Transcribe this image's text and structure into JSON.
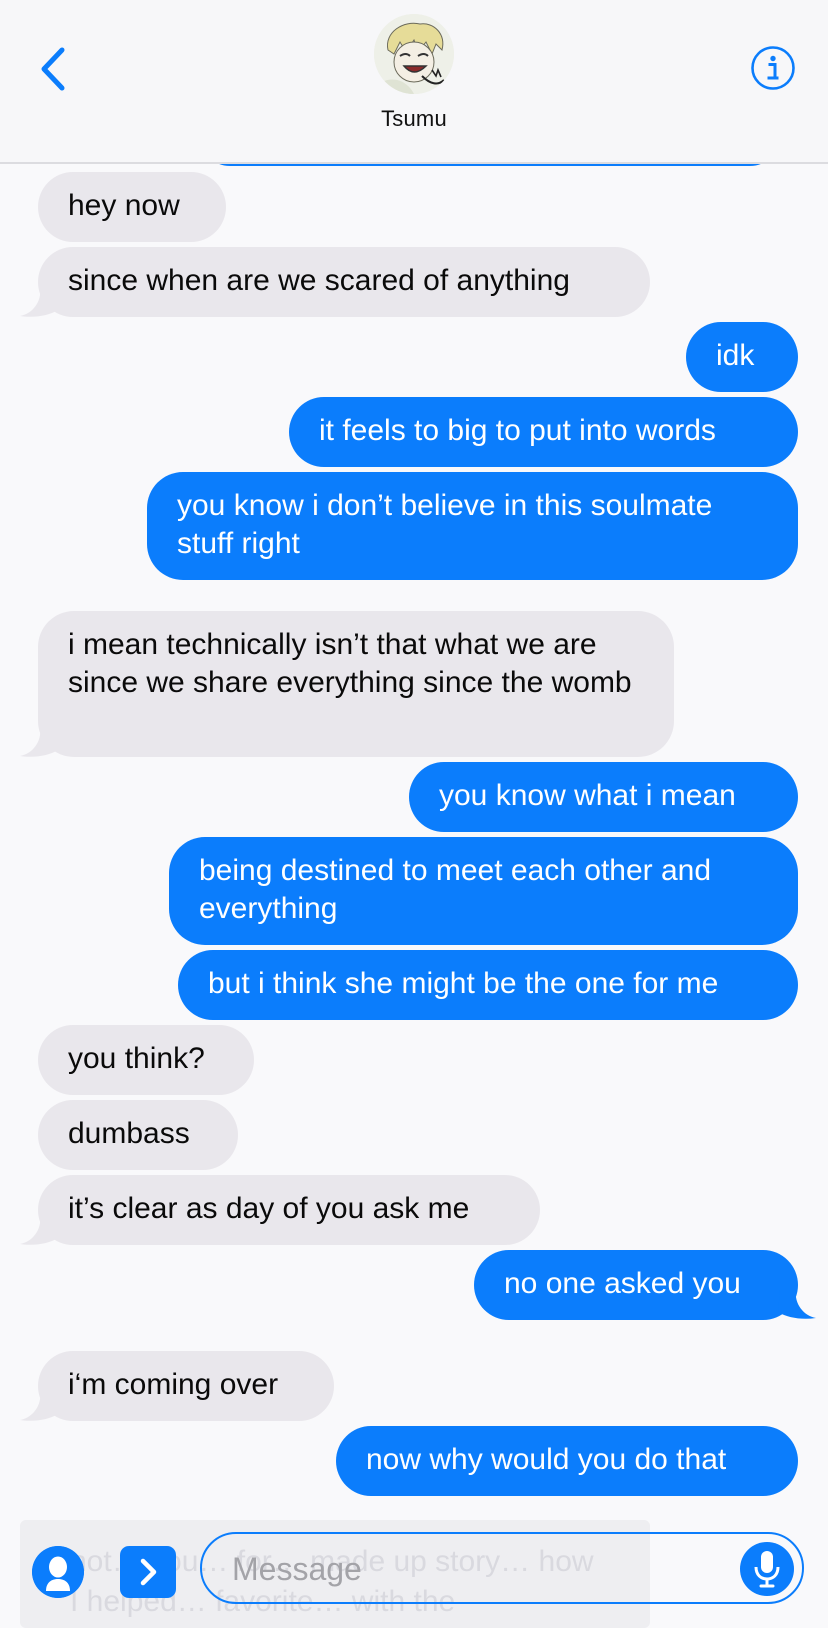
{
  "header": {
    "contact_name": "Tsumu",
    "back_icon": "chevron-left-icon",
    "info_icon": "info-icon"
  },
  "colors": {
    "accent": "#0b7dfc",
    "incoming_bubble": "#e9e7ec",
    "background": "#f9f9fb"
  },
  "messages": [
    {
      "dir": "in",
      "text": "hey now"
    },
    {
      "dir": "in",
      "text": "since when are we scared of anything"
    },
    {
      "dir": "out",
      "text": "idk"
    },
    {
      "dir": "out",
      "text": "it feels to big to put into words"
    },
    {
      "dir": "out",
      "text": "you know i don’t believe in this soulmate stuff right"
    },
    {
      "dir": "in",
      "text": "i mean technically isn’t that what we are since we share everything since the womb"
    },
    {
      "dir": "out",
      "text": "you know what i mean"
    },
    {
      "dir": "out",
      "text": "being destined to meet each other and everything"
    },
    {
      "dir": "out",
      "text": "but i think she might be the one for me"
    },
    {
      "dir": "in",
      "text": "you think?"
    },
    {
      "dir": "in",
      "text": "dumbass"
    },
    {
      "dir": "in",
      "text": "it’s clear as day of you ask me"
    },
    {
      "dir": "out",
      "text": "no one asked you"
    },
    {
      "dir": "in",
      "text": "i‘m coming over"
    },
    {
      "dir": "out",
      "text": "now why would you do that"
    }
  ],
  "input": {
    "placeholder": "Message",
    "ghost_text": "not… you… for… made up story… how I helped… favorite… with the",
    "contact_icon": "person-icon",
    "apps_icon": "chevron-right-icon",
    "mic_icon": "microphone-icon"
  }
}
